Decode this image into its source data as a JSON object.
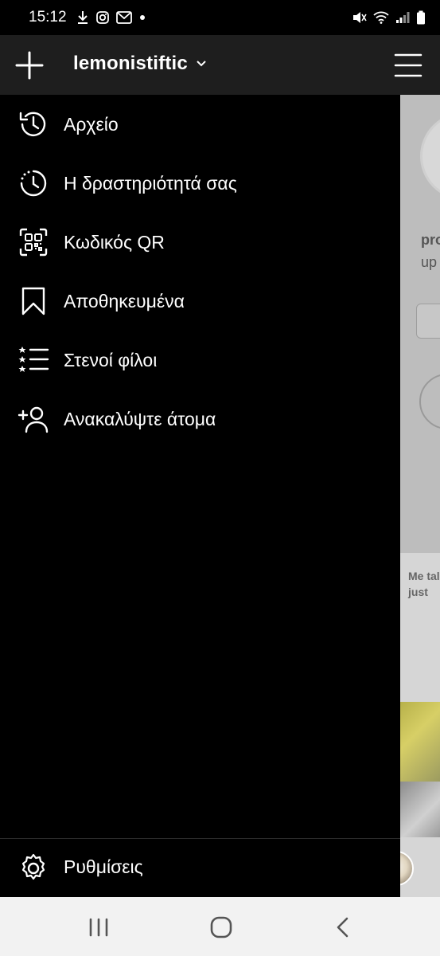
{
  "status_bar": {
    "time": "15:12",
    "left_icons": [
      "download-icon",
      "instagram-icon",
      "gmail-icon",
      "dot-icon"
    ],
    "right_icons": [
      "mute-icon",
      "wifi-icon",
      "signal-icon",
      "battery-icon"
    ]
  },
  "app_bar": {
    "username": "lemonistiftic",
    "plus_icon": "plus-icon",
    "menu_icon": "hamburger-icon"
  },
  "drawer": {
    "items": [
      {
        "label": "Αρχείο",
        "icon": "archive-history-icon"
      },
      {
        "label": "Η δραστηριότητά σας",
        "icon": "activity-clock-icon"
      },
      {
        "label": "Κωδικός QR",
        "icon": "qr-code-icon"
      },
      {
        "label": "Αποθηκευμένα",
        "icon": "bookmark-icon"
      },
      {
        "label": "Στενοί φίλοι",
        "icon": "close-friends-list-icon"
      },
      {
        "label": "Ανακαλύψτε άτομα",
        "icon": "add-person-icon"
      }
    ],
    "footer": {
      "label": "Ρυθμίσεις",
      "icon": "settings-gear-icon"
    }
  },
  "background_peek": {
    "line1": "pro",
    "line2": "up",
    "meme_line1": "Me tal",
    "meme_line2": "just"
  },
  "tab_bar": {
    "tabs": [
      "home-icon",
      "search-icon",
      "new-post-icon",
      "activity-heart-icon",
      "profile-avatar-icon"
    ]
  },
  "nav_bar": {
    "buttons": [
      "recents-icon",
      "home-circle-icon",
      "back-icon"
    ]
  },
  "colors": {
    "background": "#000000",
    "app_bar": "#1e1e1e",
    "text": "#ffffff",
    "nav_bar": "#f2f2f2"
  }
}
